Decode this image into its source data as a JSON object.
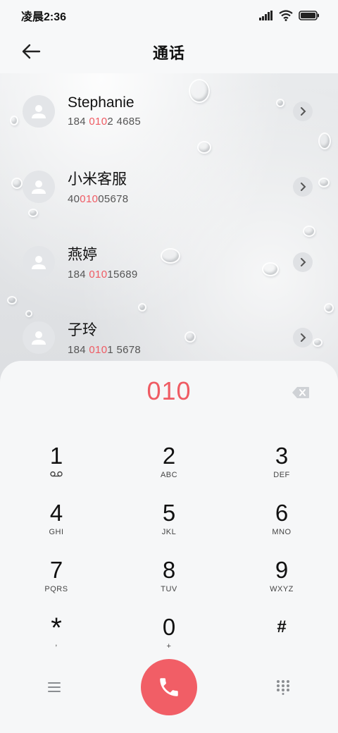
{
  "status_bar": {
    "time": "凌晨2:36",
    "icons": [
      "signal-icon",
      "wifi-icon",
      "battery-icon"
    ]
  },
  "header": {
    "title": "通话",
    "back_icon": "back-arrow-icon"
  },
  "contacts": [
    {
      "name": "Stephanie",
      "num_pre": "184 ",
      "num_hl": "010",
      "num_post": "2 4685"
    },
    {
      "name": "小米客服",
      "num_pre": "40",
      "num_hl": "010",
      "num_post": "05678"
    },
    {
      "name": "燕婷",
      "num_pre": "184 ",
      "num_hl": "010",
      "num_post": "15689"
    },
    {
      "name": "子玲",
      "num_pre": "184 ",
      "num_hl": "010",
      "num_post": "1 5678"
    }
  ],
  "dialer": {
    "input": "010",
    "keys": [
      {
        "digit": "1",
        "letters": ""
      },
      {
        "digit": "2",
        "letters": "ABC"
      },
      {
        "digit": "3",
        "letters": "DEF"
      },
      {
        "digit": "4",
        "letters": "GHI"
      },
      {
        "digit": "5",
        "letters": "JKL"
      },
      {
        "digit": "6",
        "letters": "MNO"
      },
      {
        "digit": "7",
        "letters": "PQRS"
      },
      {
        "digit": "8",
        "letters": "TUV"
      },
      {
        "digit": "9",
        "letters": "WXYZ"
      },
      {
        "digit": "*",
        "letters": ","
      },
      {
        "digit": "0",
        "letters": "+"
      },
      {
        "digit": "#",
        "letters": ""
      }
    ]
  },
  "colors": {
    "accent": "#ef5b63",
    "call_button": "#f15e66"
  }
}
